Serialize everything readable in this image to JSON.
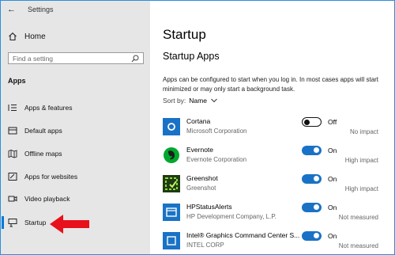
{
  "window": {
    "title": "Settings",
    "back_glyph": "←"
  },
  "sidebar": {
    "home_label": "Home",
    "search_placeholder": "Find a setting",
    "section_label": "Apps",
    "items": [
      {
        "label": "Apps & features",
        "icon": "list-icon"
      },
      {
        "label": "Default apps",
        "icon": "default-apps-icon"
      },
      {
        "label": "Offline maps",
        "icon": "map-icon"
      },
      {
        "label": "Apps for websites",
        "icon": "link-box-icon"
      },
      {
        "label": "Video playback",
        "icon": "video-icon"
      },
      {
        "label": "Startup",
        "icon": "startup-icon",
        "active": true
      }
    ],
    "annotation_arrow_color": "#e8101a"
  },
  "main": {
    "title": "Startup",
    "subtitle": "Startup Apps",
    "description": "Apps can be configured to start when you log in. In most cases apps will start minimized or may only start a background task.",
    "sort_label": "Sort by:",
    "sort_value": "Name",
    "apps": [
      {
        "name": "Cortana",
        "publisher": "Microsoft Corporation",
        "enabled": false,
        "state": "Off",
        "impact": "No impact",
        "icon_color": "#1a72c6"
      },
      {
        "name": "Evernote",
        "publisher": "Evernote Corporation",
        "enabled": true,
        "state": "On",
        "impact": "High impact",
        "icon_color": "#00a82d"
      },
      {
        "name": "Greenshot",
        "publisher": "Greenshot",
        "enabled": true,
        "state": "On",
        "impact": "High impact",
        "icon_color": "#1f3b12"
      },
      {
        "name": "HPStatusAlerts",
        "publisher": "HP Development Company, L.P.",
        "enabled": true,
        "state": "On",
        "impact": "Not measured",
        "icon_color": "#1a72c6"
      },
      {
        "name": "Intel® Graphics Command Center S...",
        "publisher": "INTEL CORP",
        "enabled": true,
        "state": "On",
        "impact": "Not measured",
        "icon_color": "#1a72c6"
      }
    ]
  },
  "colors": {
    "accent": "#0078d7",
    "toggle_on": "#1a72c6",
    "sidebar_bg": "#e6e6e6"
  }
}
